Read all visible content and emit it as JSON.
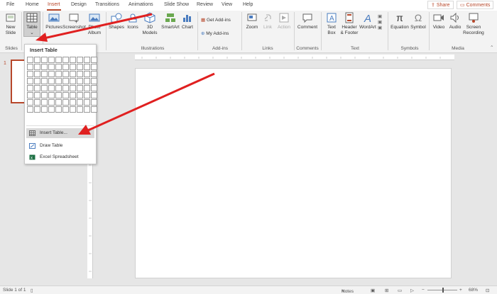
{
  "tabs": [
    "File",
    "Home",
    "Insert",
    "Design",
    "Transitions",
    "Animations",
    "Slide Show",
    "Review",
    "View",
    "Help"
  ],
  "top_buttons": {
    "share": "Share",
    "comments": "Comments"
  },
  "ribbon": {
    "new_slide": [
      "New",
      "Slide"
    ],
    "table": "Table",
    "pictures": "Pictures",
    "screenshot": "Screenshot",
    "photo_album": [
      "Photo",
      "Album"
    ],
    "shapes": "Shapes",
    "icons": "Icons",
    "models": [
      "3D",
      "Models"
    ],
    "smartart": "SmartArt",
    "chart": "Chart",
    "get_addins": "Get Add-ins",
    "my_addins": "My Add-ins",
    "zoom": "Zoom",
    "link": "Link",
    "action": "Action",
    "comment": "Comment",
    "text_box": [
      "Text",
      "Box"
    ],
    "header_footer": [
      "Header",
      "& Footer"
    ],
    "wordart": "WordArt",
    "equation": "Equation",
    "symbol": "Symbol",
    "video": "Video",
    "audio": "Audio",
    "screen_recording": [
      "Screen",
      "Recording"
    ],
    "groups": [
      "Slides",
      "Illustrations",
      "Add-ins",
      "Links",
      "Comments",
      "Text",
      "Symbols",
      "Media"
    ]
  },
  "dropdown": {
    "title": "Insert Table",
    "items": [
      "Insert Table...",
      "Draw Table",
      "Excel Spreadsheet"
    ]
  },
  "thumbnail": {
    "number": "1"
  },
  "status": {
    "slide": "Slide 1 of 1",
    "notes": "Notes",
    "zoom": "68%"
  },
  "colors": {
    "accent": "#b7472a",
    "arrow": "#e02020"
  }
}
